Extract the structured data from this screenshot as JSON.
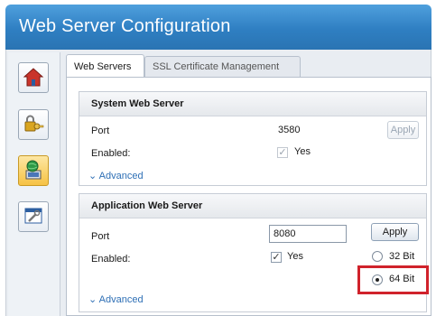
{
  "window": {
    "title": "Web Server Configuration"
  },
  "nav": {
    "items": [
      {
        "name": "home",
        "icon": "home-icon"
      },
      {
        "name": "security",
        "icon": "lock-key-icon"
      },
      {
        "name": "network",
        "icon": "globe-computer-icon",
        "active": true
      },
      {
        "name": "settings",
        "icon": "window-wrench-icon"
      }
    ]
  },
  "tabs": [
    {
      "label": "Web Servers",
      "active": true
    },
    {
      "label": "SSL Certificate Management",
      "active": false
    }
  ],
  "system_server": {
    "title": "System Web Server",
    "port_label": "Port",
    "port_value": "3580",
    "apply_label": "Apply",
    "apply_enabled": false,
    "enabled_label": "Enabled:",
    "enabled_value": "Yes",
    "enabled_checked": true,
    "advanced_label": "Advanced"
  },
  "app_server": {
    "title": "Application Web Server",
    "port_label": "Port",
    "port_value": "8080",
    "apply_label": "Apply",
    "enabled_label": "Enabled:",
    "enabled_value": "Yes",
    "enabled_checked": true,
    "advanced_label": "Advanced",
    "bitness_options": [
      {
        "label": "32 Bit",
        "selected": false
      },
      {
        "label": "64 Bit",
        "selected": true
      }
    ]
  },
  "colors": {
    "title_bar": "#2f7fc2",
    "highlight": "#d0222b",
    "link": "#2e6fb5"
  }
}
